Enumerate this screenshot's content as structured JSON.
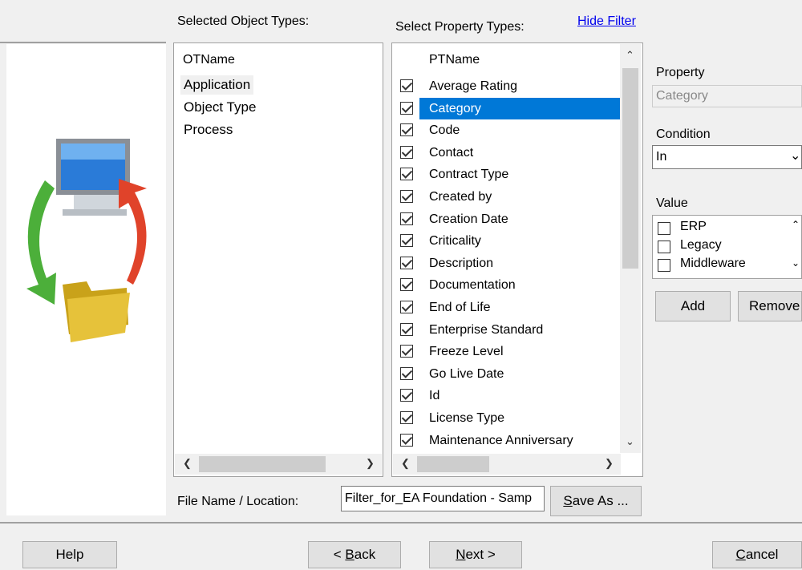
{
  "headers": {
    "selected_object_types": "Selected Object Types:",
    "select_property_types": "Select Property Types:",
    "hide_filter": "Hide Filter"
  },
  "object_types": {
    "column": "OTName",
    "items": [
      "Application",
      "Object Type",
      "Process"
    ]
  },
  "property_types": {
    "column": "PTName",
    "items": [
      {
        "label": "Average Rating",
        "checked": true
      },
      {
        "label": "Category",
        "checked": true,
        "selected": true
      },
      {
        "label": "Code",
        "checked": true
      },
      {
        "label": "Contact",
        "checked": true
      },
      {
        "label": "Contract Type",
        "checked": true
      },
      {
        "label": "Created by",
        "checked": true
      },
      {
        "label": "Creation Date",
        "checked": true
      },
      {
        "label": "Criticality",
        "checked": true
      },
      {
        "label": "Description",
        "checked": true
      },
      {
        "label": "Documentation",
        "checked": true
      },
      {
        "label": "End of Life",
        "checked": true
      },
      {
        "label": "Enterprise Standard",
        "checked": true
      },
      {
        "label": "Freeze Level",
        "checked": true
      },
      {
        "label": "Go Live Date",
        "checked": true
      },
      {
        "label": "Id",
        "checked": true
      },
      {
        "label": "License Type",
        "checked": true
      },
      {
        "label": "Maintenance Anniversary",
        "checked": true
      }
    ]
  },
  "filter": {
    "property_label": "Property",
    "property_value": "Category",
    "condition_label": "Condition",
    "condition_value": "In",
    "value_label": "Value",
    "values": [
      {
        "label": "ERP",
        "checked": false
      },
      {
        "label": "Legacy",
        "checked": false
      },
      {
        "label": "Middleware",
        "checked": false
      }
    ],
    "add_label": "Add",
    "remove_label": "Remove"
  },
  "file": {
    "label": "File Name / Location:",
    "value": "Filter_for_EA Foundation - Samp",
    "save_as_pre": "",
    "save_as_u": "S",
    "save_as_post": "ave As ..."
  },
  "footer": {
    "help": "Help",
    "back_pre": "< ",
    "back_u": "B",
    "back_post": "ack",
    "next_u": "N",
    "next_post": "ext >",
    "cancel_u": "C",
    "cancel_post": "ancel"
  },
  "colors": {
    "selection": "#0078d7",
    "link": "#0000ee"
  }
}
